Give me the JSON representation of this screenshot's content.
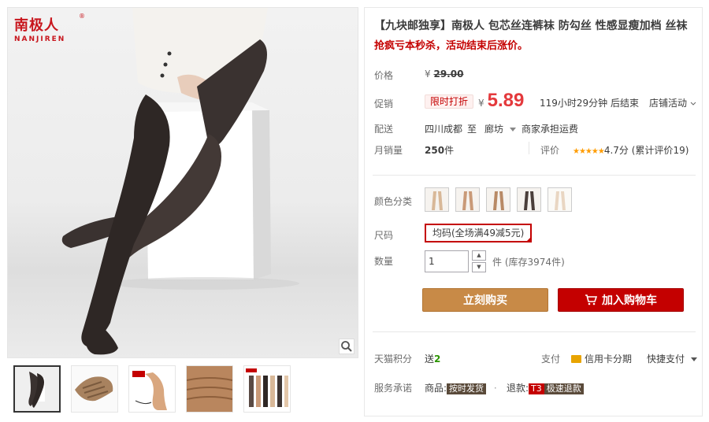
{
  "brand": {
    "logo_cn": "南极人",
    "logo_en": "NANJIREN",
    "logo_reg": "®"
  },
  "product": {
    "title": "【九块邮独享】南极人 包芯丝连裤袜 防勾丝 性感显瘦加档 丝袜",
    "subtitle": "抢疯亏本秒杀，活动结束后涨价。"
  },
  "price": {
    "label": "价格",
    "currency": "¥",
    "original": "29.00"
  },
  "promo": {
    "label": "促销",
    "tag": "限时打折",
    "currency": "¥",
    "price": "5.89",
    "countdown": "119小时29分钟 后结束",
    "shop_activity": "店铺活动"
  },
  "shipping": {
    "label": "配送",
    "from": "四川成都",
    "to_word": "至",
    "to": "廊坊",
    "fee": "商家承担运费"
  },
  "sales": {
    "label": "月销量",
    "count": "250",
    "unit": "件",
    "rating_label": "评价",
    "stars": "★★★★★",
    "score": "4.7分",
    "reviews_prefix": "(累计评价",
    "reviews_count": "19",
    "reviews_suffix": ")"
  },
  "options": {
    "color_label": "颜色分类",
    "size_label": "尺码",
    "size_value": "均码(全场满49减5元)",
    "qty_label": "数量",
    "qty_value": "1",
    "stock_unit": "件",
    "stock": "(库存3974件)"
  },
  "buttons": {
    "buy": "立刻购买",
    "cart": "加入购物车"
  },
  "points": {
    "label": "天猫积分",
    "give": "送",
    "value": "2"
  },
  "payment": {
    "label": "支付",
    "credit": "信用卡分期",
    "quick": "快捷支付"
  },
  "service": {
    "label": "服务承诺",
    "goods_prefix": "商品:",
    "goods_badge": "按时发货",
    "dot": "·",
    "refund_prefix": "退款:",
    "refund_badge_t3": "T3",
    "refund_badge_rest": "极速退款"
  },
  "colors": {
    "accent_red": "#c40000",
    "buy_button": "#c88a47",
    "cart_button": "#c40000",
    "price_red": "#e4393c",
    "star": "#ff9c00"
  },
  "icons": [
    "zoom-icon",
    "cart-icon",
    "credit-card-icon",
    "chevron-down-icon",
    "triangle-down-icon"
  ]
}
